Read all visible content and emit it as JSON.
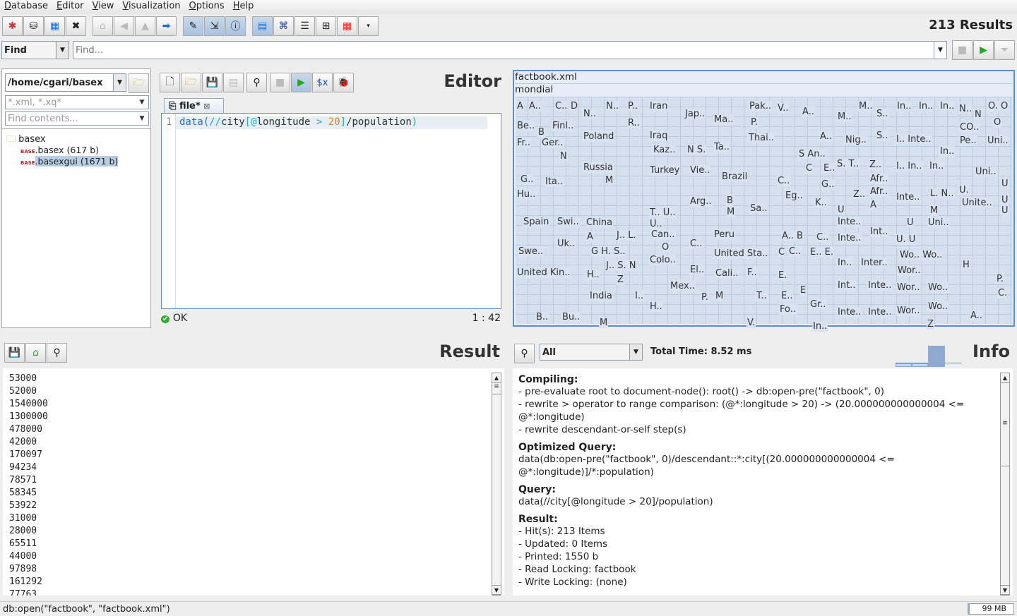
{
  "menu": [
    "Database",
    "Editor",
    "View",
    "Visualization",
    "Options",
    "Help"
  ],
  "toolbar": {
    "icons": [
      "new-database-icon",
      "open-database-icon",
      "properties-icon",
      "close-icon",
      "home-icon",
      "back-icon",
      "up-icon",
      "forward-icon",
      "editor-icon",
      "result-icon",
      "info-icon",
      "map-view-icon",
      "tree-view-icon",
      "folder-view-icon",
      "plot-view-icon",
      "table-view-icon",
      "more-views-icon"
    ],
    "results": "213 Results"
  },
  "find": {
    "mode": "Find",
    "placeholder": "Find..."
  },
  "project": {
    "path": "/home/cgari/basex",
    "filter_placeholder": "*.xml, *.xq*",
    "contents_placeholder": "Find contents...",
    "tree": [
      {
        "label": "basex"
      },
      {
        "label": ".basex (617 b)"
      },
      {
        "label": ".basexgui (1671 b)"
      }
    ]
  },
  "editor": {
    "title": "Editor",
    "tab": "file*",
    "line_no": "1",
    "code": {
      "p1": "data(",
      "p2": "//",
      "p3": "city",
      "p4": "[",
      "p5": "@",
      "p6": "longitude",
      "p7": " > ",
      "p8": "20",
      "p9": "]",
      "p10": "/population",
      "p11": ")"
    },
    "status": "OK",
    "cursor": "1 : 42"
  },
  "map": {
    "path": "factbook.xml",
    "root": "mondial",
    "labels": [
      "A",
      "A..",
      "C..",
      "D",
      "N..",
      "N..",
      "P..",
      "Iran",
      "Jap..",
      "Ma..",
      "Pak..",
      "P.",
      "V..",
      "A..",
      "M..",
      "M..",
      "S..",
      "In..",
      "In..",
      "In..",
      "N..",
      "N",
      "O. O",
      "Be..",
      "B",
      "Finl..",
      "R..",
      "Iraq",
      "Poland",
      "Thai..",
      "A..",
      "Nig..",
      "S..",
      "I.. Inte..",
      "CO..",
      "O",
      "Pe..",
      "Uni..",
      "Fr..",
      "Ger..",
      "N",
      "Kaz..",
      "N S.",
      "Ta..",
      "S An..",
      "In..",
      "Russia",
      "M",
      "Turkey",
      "Vie..",
      "Brazil",
      "C..",
      "E..",
      "C",
      "S. T..",
      "Z..",
      "Afr..",
      "Afr..",
      "I.. In..",
      "In..",
      "Uni..",
      "G..",
      "Ita..",
      "G..",
      "Hu..",
      "Eg..",
      "K..",
      "Arg..",
      "B",
      "M",
      "Sa..",
      "Z..",
      "A",
      "Inte..",
      "L. N..",
      "U.",
      "Unite..",
      "U",
      "U",
      "U",
      "U",
      "M",
      "T.. U..",
      "U..",
      "Spain",
      "Swi..",
      "China",
      "Inte..",
      "U",
      "Uni..",
      "Can..",
      "O",
      "Peru",
      "C..",
      "A.. B",
      "C..",
      "Int..",
      "A",
      "J.. L.",
      "Uk..",
      "Inte..",
      "U. U",
      "Swe..",
      "G H. S..",
      "C",
      "C..",
      "E.. E.",
      "United Sta..",
      "Wo.. Wo..",
      "Colo..",
      "J.. S. N",
      "H",
      "In..",
      "Inter..",
      "United Kin..",
      "H..",
      "Z",
      "Cali..",
      "F..",
      "El..",
      "Wor..",
      "E.",
      "P.",
      "Mex..",
      "Int..",
      "Inte..",
      "Wor..",
      "Wo..",
      "E",
      "E..",
      "C.",
      "India",
      "I..",
      "P.",
      "M",
      "T..",
      "H..",
      "Gr..",
      "Fo..",
      "Inte..",
      "Inte..",
      "Wor..",
      "Wo..",
      "A..",
      "B..",
      "Bu..",
      "M",
      "V.",
      "Z",
      "In.."
    ]
  },
  "result": {
    "title": "Result",
    "values": [
      "53000",
      "52000",
      "1540000",
      "1300000",
      "478000",
      "42000",
      "170097",
      "94234",
      "78571",
      "58345",
      "53922",
      "31000",
      "28000",
      "65511",
      "44000",
      "97898",
      "161292",
      "77763"
    ]
  },
  "info": {
    "title": "Info",
    "filter": "All",
    "total_time": "Total Time: 8.52 ms",
    "sections": [
      {
        "heading": "Compiling:",
        "lines": [
          "- pre-evaluate root to document-node(): root() -> db:open-pre(\"factbook\", 0)",
          "- rewrite > operator to range comparison: (@*:longitude > 20) -> (20.000000000000004 <= @*:longitude)",
          "- rewrite descendant-or-self step(s)"
        ]
      },
      {
        "heading": "Optimized Query:",
        "lines": [
          "data(db:open-pre(\"factbook\", 0)/descendant::*:city[(20.000000000000004 <= @*:longitude)]/*:population)"
        ]
      },
      {
        "heading": "Query:",
        "lines": [
          "data(//city[@longitude > 20]/population)"
        ]
      },
      {
        "heading": "Result:",
        "lines": [
          "- Hit(s): 213 Items",
          "- Updated: 0 Items",
          "- Printed: 1550 b",
          "- Read Locking: factbook",
          "- Write Locking: (none)"
        ]
      }
    ]
  },
  "statusbar": {
    "command": "db:open(\"factbook\", \"factbook.xml\")",
    "memory": "99 MB"
  }
}
